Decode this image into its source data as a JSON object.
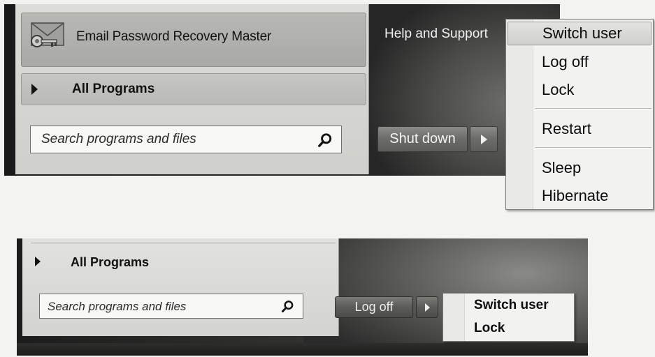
{
  "top_menu": {
    "program_item": {
      "label": "Email Password Recovery Master",
      "icon": "envelope-key-icon"
    },
    "all_programs": "All Programs",
    "search_placeholder": "Search programs and files",
    "help_link": "Help and Support",
    "shutdown_button": "Shut down",
    "shutdown_menu": {
      "items": [
        "Switch user",
        "Log off",
        "Lock",
        "Restart",
        "Sleep",
        "Hibernate"
      ]
    }
  },
  "bottom_menu": {
    "all_programs": "All Programs",
    "search_placeholder": "Search programs and files",
    "logoff_button": "Log off",
    "logoff_menu": {
      "items": [
        "Switch user",
        "Lock"
      ]
    }
  },
  "colors": {
    "menu_background": "#f2f2f0",
    "panel_dark": "#1a1a1a",
    "left_column": "#d6d7d2"
  }
}
